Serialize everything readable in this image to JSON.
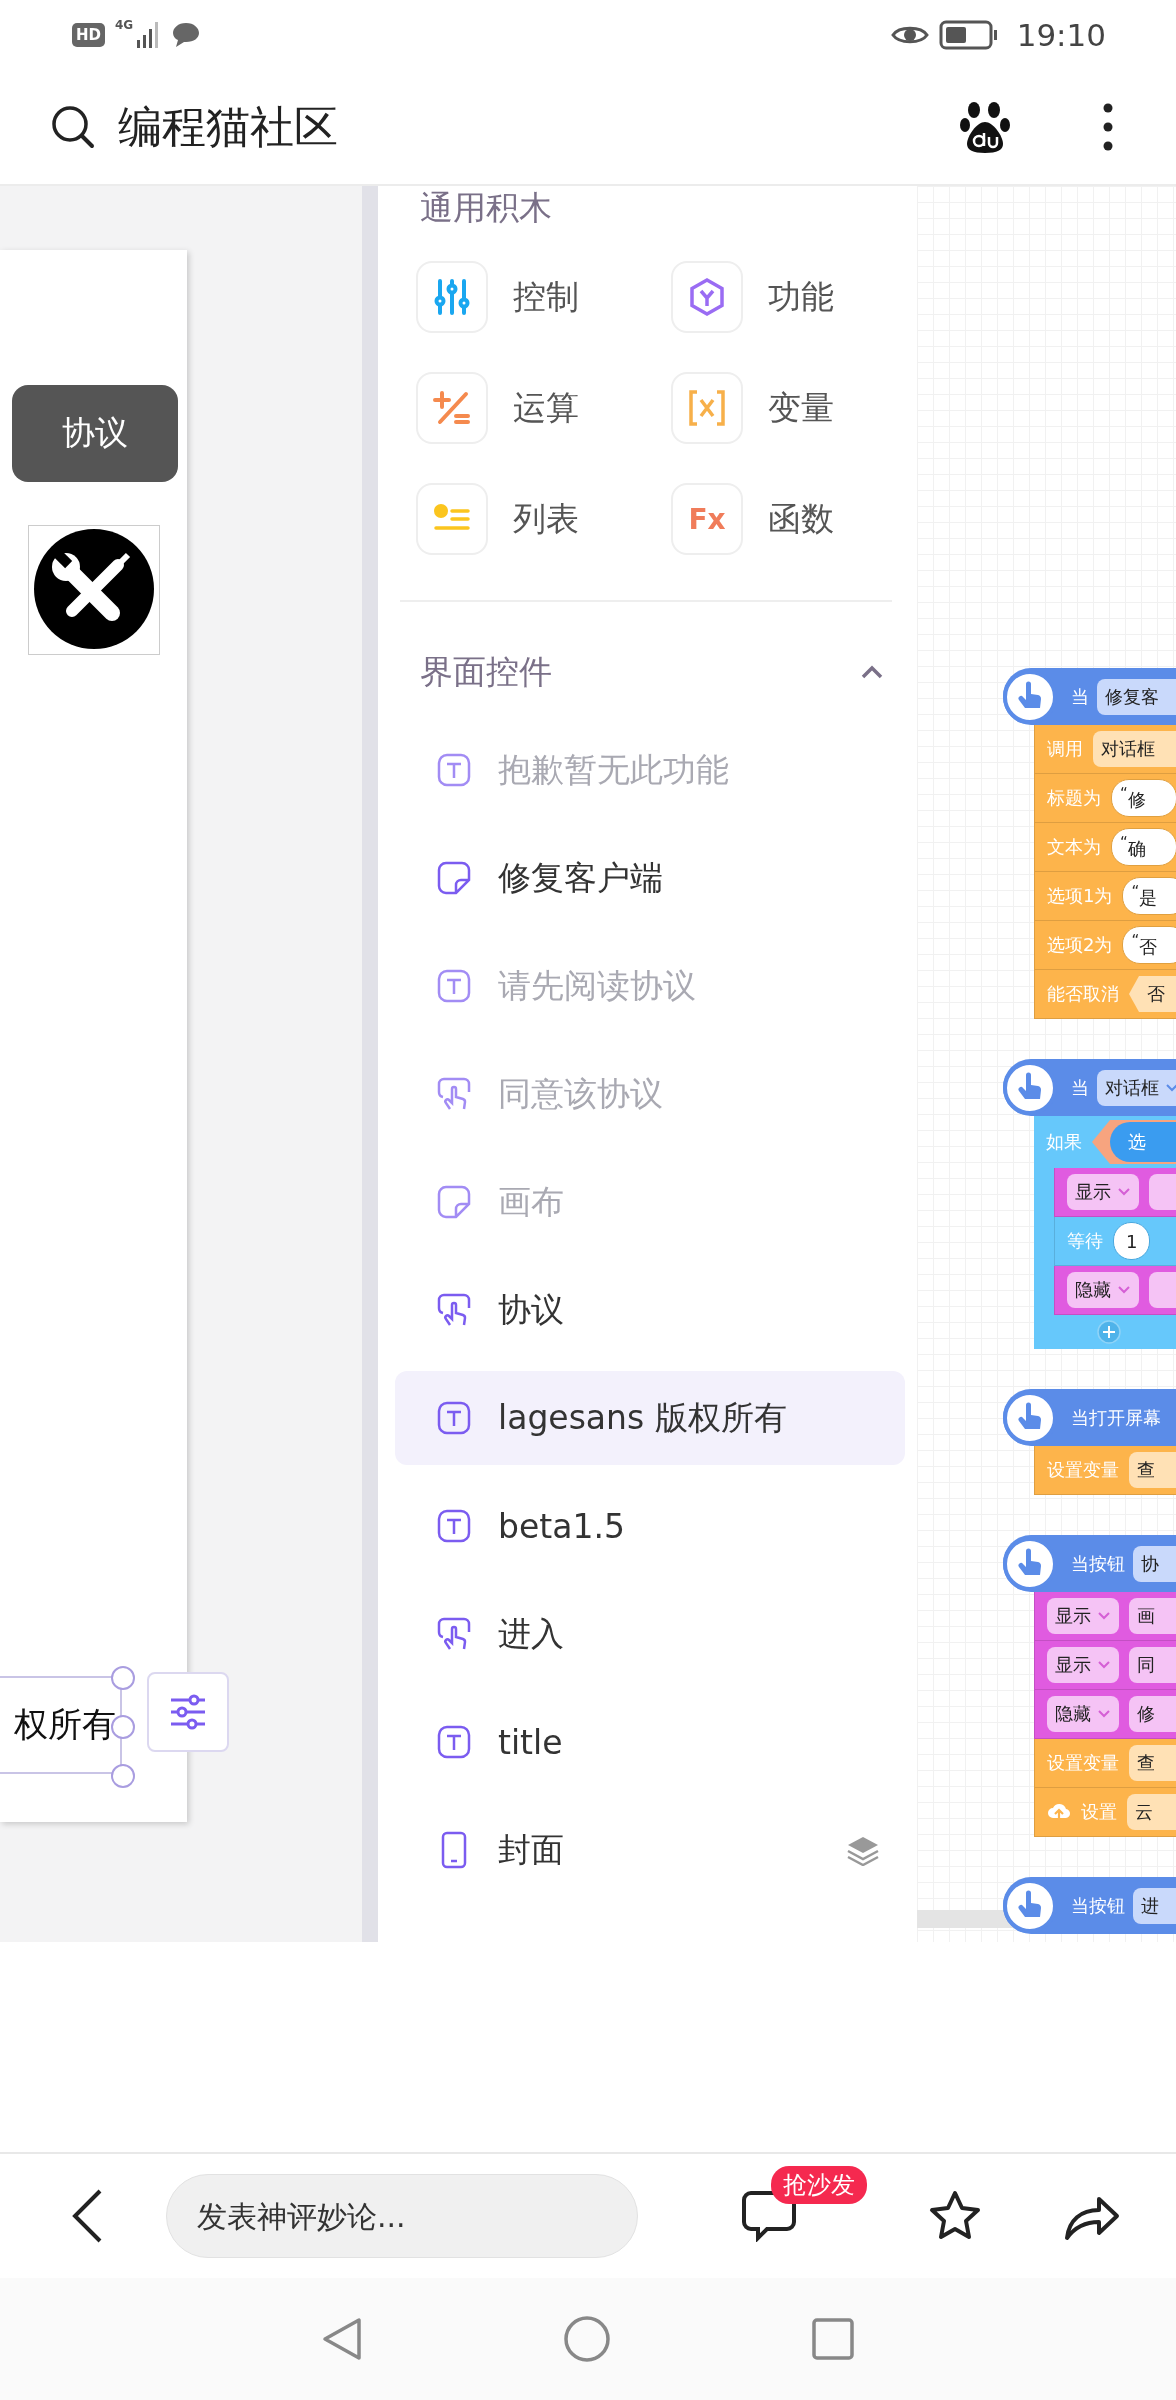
{
  "status_bar": {
    "badge": "HD",
    "network": "4G",
    "time": "19:10"
  },
  "header": {
    "title": "编程猫社区"
  },
  "stage": {
    "button": "协议",
    "text_fragment": "权所有"
  },
  "palette": {
    "section_title": "通用积木",
    "categories": [
      {
        "label": "控制",
        "kind": "control"
      },
      {
        "label": "功能",
        "kind": "function"
      },
      {
        "label": "运算",
        "kind": "operator"
      },
      {
        "label": "变量",
        "kind": "variable"
      },
      {
        "label": "列表",
        "kind": "list"
      },
      {
        "label": "函数",
        "kind": "procedure",
        "icon_text": "Fx"
      }
    ],
    "widgets": {
      "title": "界面控件",
      "expanded": true,
      "items": [
        {
          "label": "抱歉暂无此功能",
          "kind": "text",
          "hidden": true,
          "selected": false
        },
        {
          "label": "修复客户端",
          "kind": "canvas",
          "hidden": false,
          "selected": false
        },
        {
          "label": "请先阅读协议",
          "kind": "text",
          "hidden": true,
          "selected": false
        },
        {
          "label": "同意该协议",
          "kind": "button",
          "hidden": true,
          "selected": false
        },
        {
          "label": "画布",
          "kind": "canvas",
          "hidden": true,
          "selected": false
        },
        {
          "label": "协议",
          "kind": "button",
          "hidden": false,
          "selected": false
        },
        {
          "label": "lagesans 版权所有",
          "kind": "text",
          "hidden": false,
          "selected": true
        },
        {
          "label": "beta1.5",
          "kind": "text",
          "hidden": false,
          "selected": false
        },
        {
          "label": "进入",
          "kind": "button",
          "hidden": false,
          "selected": false
        },
        {
          "label": "title",
          "kind": "text",
          "hidden": false,
          "selected": false
        },
        {
          "label": "封面",
          "kind": "screen",
          "hidden": false,
          "selected": false
        }
      ]
    }
  },
  "canvas": {
    "scripts": [
      {
        "hat": {
          "label": "当",
          "field": {
            "kind": "field",
            "text": "修复客"
          }
        },
        "blocks": [
          {
            "kind": "action",
            "label": "调用",
            "slots": [
              {
                "kind": "field",
                "text": "对话框"
              }
            ]
          },
          {
            "kind": "action",
            "label": "标题为",
            "slots": [
              {
                "kind": "string",
                "text": "$^{“}$修"
              }
            ]
          },
          {
            "kind": "action",
            "label": "文本为",
            "slots": [
              {
                "kind": "string",
                "text": "$^{“}$确"
              }
            ]
          },
          {
            "kind": "action",
            "label": "选项1为",
            "slots": [
              {
                "kind": "string",
                "text": "$^{“}$是"
              }
            ]
          },
          {
            "kind": "action",
            "label": "选项2为",
            "slots": [
              {
                "kind": "string",
                "text": "$^{“}$否"
              }
            ]
          },
          {
            "kind": "action",
            "label": "能否取消",
            "slots": [
              {
                "kind": "bool",
                "text": "否"
              }
            ]
          }
        ]
      },
      {
        "hat": {
          "label": "当",
          "field": {
            "kind": "select",
            "text": "对话框"
          }
        },
        "blocks": [
          {
            "kind": "if",
            "label": "如果",
            "slots": [
              {
                "kind": "condition",
                "text": "选"
              }
            ],
            "children": [
              {
                "kind": "widget",
                "slots": [
                  {
                    "kind": "select",
                    "text": "显示"
                  },
                  {
                    "kind": "field"
                  }
                ]
              },
              {
                "kind": "control",
                "label": "等待",
                "slots": [
                  {
                    "kind": "number",
                    "text": "1"
                  }
                ]
              },
              {
                "kind": "widget",
                "slots": [
                  {
                    "kind": "select",
                    "text": "隐藏"
                  },
                  {
                    "kind": "field"
                  }
                ]
              }
            ]
          }
        ]
      },
      {
        "hat": {
          "label": "当打开屏幕"
        },
        "blocks": [
          {
            "kind": "action",
            "label": "设置变量",
            "slots": [
              {
                "kind": "field",
                "text": "查"
              }
            ]
          }
        ]
      },
      {
        "hat": {
          "label": "当按钮",
          "field": {
            "kind": "field",
            "text": "协"
          }
        },
        "blocks": [
          {
            "kind": "widget",
            "slots": [
              {
                "kind": "select",
                "text": "显示"
              },
              {
                "kind": "field",
                "text": "画"
              }
            ]
          },
          {
            "kind": "widget",
            "slots": [
              {
                "kind": "select",
                "text": "显示"
              },
              {
                "kind": "field",
                "text": "同"
              }
            ]
          },
          {
            "kind": "widget",
            "slots": [
              {
                "kind": "select",
                "text": "隐藏"
              },
              {
                "kind": "field",
                "text": "修"
              }
            ]
          },
          {
            "kind": "action",
            "label": "设置变量",
            "slots": [
              {
                "kind": "field",
                "text": "查"
              }
            ]
          },
          {
            "kind": "cloud",
            "label": "设置",
            "slots": [
              {
                "kind": "field",
                "text": "云"
              }
            ]
          }
        ]
      },
      {
        "hat": {
          "label": "当按钮",
          "field": {
            "kind": "field",
            "text": "进"
          }
        }
      }
    ]
  },
  "comment_bar": {
    "placeholder": "发表神评妙论...",
    "badge": "抢沙发"
  }
}
